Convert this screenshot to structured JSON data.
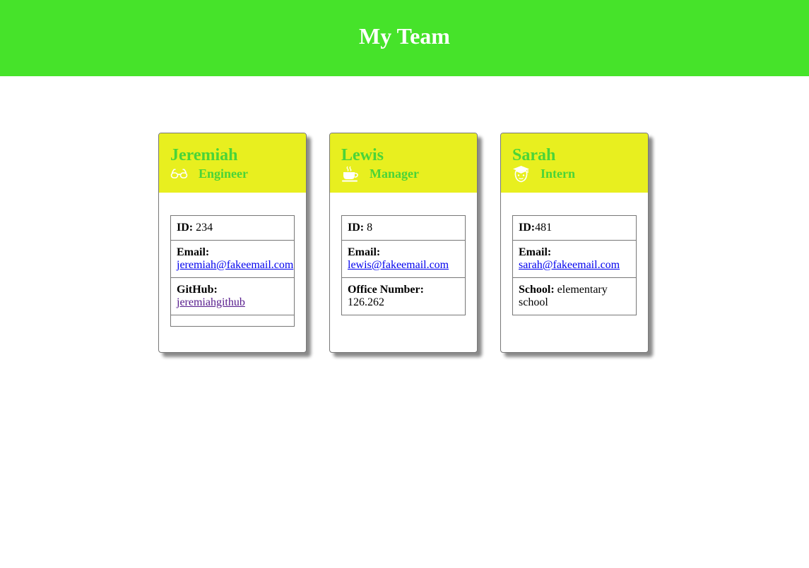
{
  "header": {
    "title": "My Team"
  },
  "colors": {
    "header_bg": "#46e32a",
    "card_head_bg": "#e8ef1f",
    "card_title": "#4ad438"
  },
  "cards": [
    {
      "name": "Jeremiah",
      "role": "Engineer",
      "icon": "glasses-icon",
      "id_label": "ID:",
      "id_value": " 234",
      "email_label": "Email:",
      "email": "jeremiah@fakeemail.com",
      "extra_label": "GitHub:",
      "extra_value": "jeremiahgithub"
    },
    {
      "name": "Lewis",
      "role": "Manager",
      "icon": "coffee-cup-icon",
      "id_label": "ID:",
      "id_value": " 8",
      "email_label": "Email:",
      "email": "lewis@fakeemail.com",
      "extra_label": "Office Number:",
      "extra_value": "126.262"
    },
    {
      "name": "Sarah",
      "role": "Intern",
      "icon": "graduate-icon",
      "id_label": "ID:",
      "id_value": "481",
      "email_label": "Email:",
      "email": "sarah@fakeemail.com",
      "extra_label": "School:",
      "extra_value": " elementary school"
    }
  ]
}
